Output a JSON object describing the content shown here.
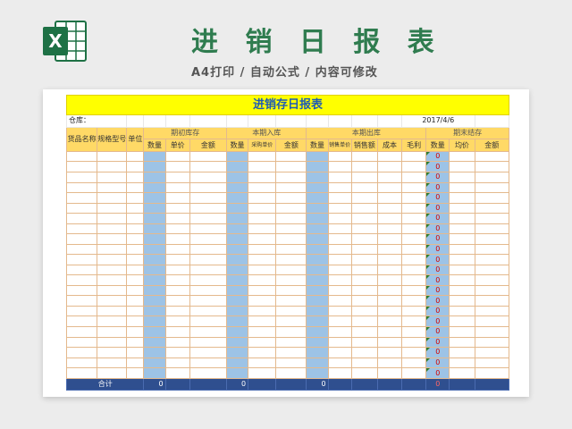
{
  "header": {
    "title": "进 销 日 报 表",
    "subtitle": "A4打印 / 自动公式 / 内容可修改"
  },
  "logo": {
    "letter": "X",
    "name": "excel-icon",
    "color": "#1e7145"
  },
  "sheet": {
    "title": "进销存日报表",
    "warehouse_label": "仓库：",
    "date": "2017/4/6",
    "groups": [
      "期初库存",
      "本期入库",
      "本期出库",
      "期末结存"
    ],
    "columns": {
      "name": "货品名称",
      "model": "规格型号",
      "unit": "单位",
      "open_qty": "数量",
      "open_price": "单价",
      "open_amount": "金额",
      "in_qty": "数量",
      "in_price": "采购单价",
      "in_amount": "金额",
      "out_qty": "数量",
      "out_price": "销售单价",
      "out_sales": "销售额",
      "out_cost": "成本",
      "out_profit": "毛利",
      "end_qty": "数量",
      "end_price": "均价",
      "end_amount": "金额"
    },
    "body_rows": 22,
    "end_qty_value": "0",
    "total": {
      "label": "合计",
      "open_qty": "0",
      "in_qty": "0",
      "out_qty": "0",
      "end_qty": "0"
    }
  },
  "colors": {
    "title_green": "#2f7c4f",
    "yellow": "#ffff00",
    "header": "#ffd966",
    "blue_col": "#9dc3e6",
    "total_bar": "#2f4f8f",
    "red": "#d40000"
  }
}
